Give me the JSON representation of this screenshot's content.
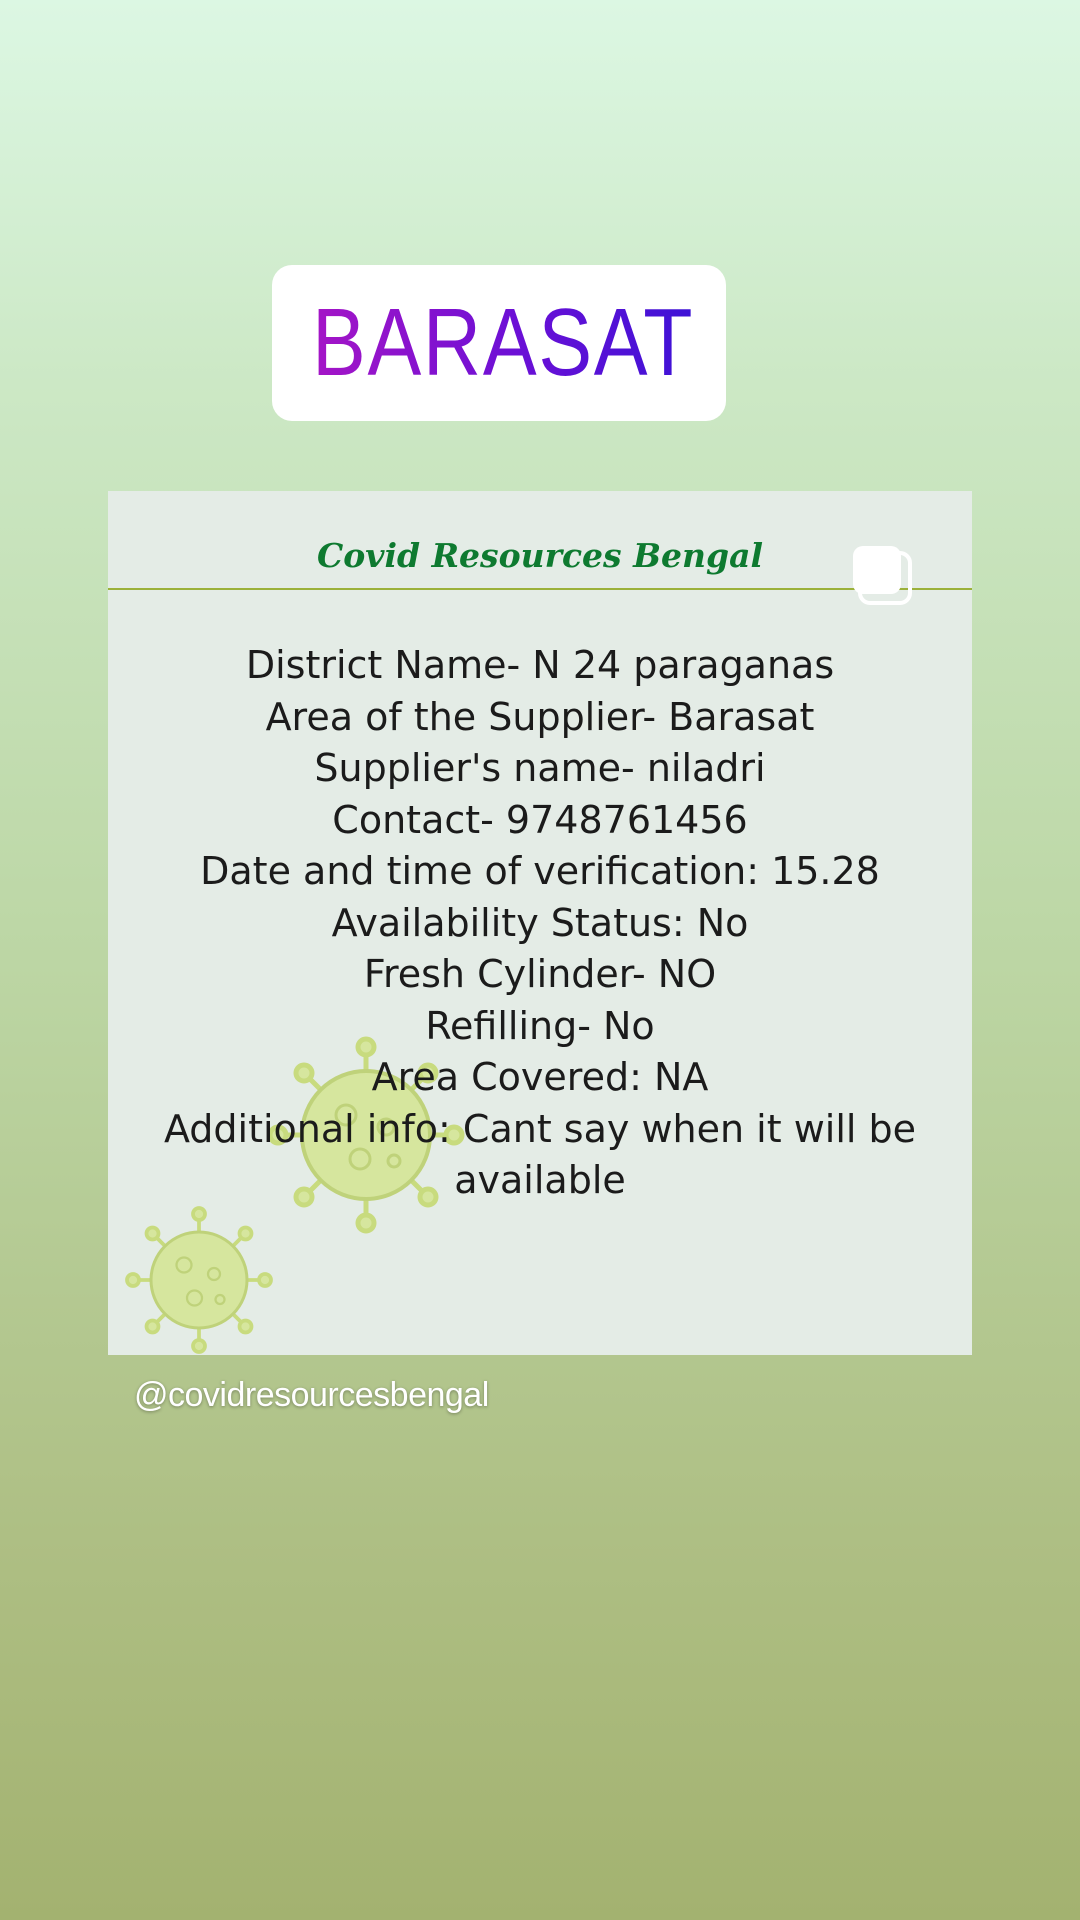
{
  "location_sticker": {
    "icon": "map-pin-icon",
    "text": "BARASAT",
    "gradient_colors": [
      "#a515c6",
      "#3d12d6"
    ]
  },
  "card": {
    "brand_title": "Covid Resources Bengal",
    "copy_icon": "copy-icon",
    "decoration_icon": "virus-icon",
    "info_lines": [
      "District Name- N 24 paraganas",
      "Area of the Supplier- Barasat",
      "Supplier's name- niladri",
      "Contact- 9748761456",
      "Date and time of verification: 15.28",
      "Availability Status: No",
      "Fresh Cylinder- NO",
      "Refilling- No",
      "Area Covered: NA",
      "Additional info: Cant say when it will be available"
    ]
  },
  "handle": "@covidresourcesbengal",
  "colors": {
    "brand_green": "#0e7a30",
    "header_rule": "#9bb13a",
    "card_background": "#e4ece6"
  }
}
